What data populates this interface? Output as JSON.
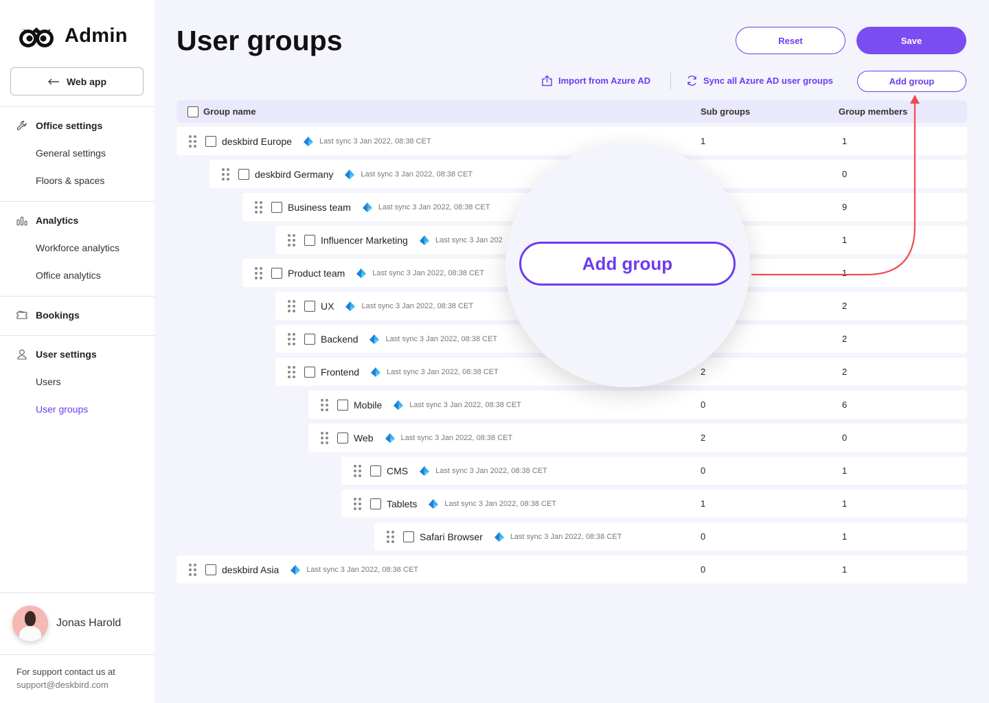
{
  "app": {
    "title": "Admin"
  },
  "sidebar": {
    "back_button": "Web app",
    "sections": [
      {
        "title": "Office settings",
        "icon": "wrench-icon",
        "items": [
          "General settings",
          "Floors & spaces"
        ]
      },
      {
        "title": "Analytics",
        "icon": "bar-chart-icon",
        "items": [
          "Workforce analytics",
          "Office analytics"
        ]
      },
      {
        "title": "Bookings",
        "icon": "ticket-icon",
        "items": []
      },
      {
        "title": "User settings",
        "icon": "user-icon",
        "items": [
          "Users",
          "User groups"
        ]
      }
    ],
    "active_item": "User groups",
    "user": {
      "name": "Jonas Harold"
    },
    "support": {
      "line": "For support contact us at",
      "email": "support@deskbird.com"
    }
  },
  "header": {
    "title": "User groups",
    "reset": "Reset",
    "save": "Save",
    "import_azure": "Import from Azure AD",
    "sync_azure": "Sync all Azure AD user groups",
    "add_group": "Add group"
  },
  "table": {
    "columns": [
      "Group name",
      "Sub groups",
      "Group members"
    ],
    "rows": [
      {
        "name": "deskbird Europe",
        "sync": "Last sync 3 Jan 2022, 08:38 CET",
        "sub": "1",
        "members": "1",
        "level": 0
      },
      {
        "name": "deskbird Germany",
        "sync": "Last sync 3 Jan 2022, 08:38 CET",
        "sub": "",
        "members": "0",
        "level": 1
      },
      {
        "name": "Business team",
        "sync": "Last sync 3 Jan 2022, 08:38 CET",
        "sub": "",
        "members": "9",
        "level": 2
      },
      {
        "name": "Influencer Marketing",
        "sync": "Last sync 3 Jan 202",
        "sub": "",
        "members": "1",
        "level": 3
      },
      {
        "name": "Product team",
        "sync": "Last sync 3 Jan 2022, 08:38 CET",
        "sub": "",
        "members": "1",
        "level": 2
      },
      {
        "name": "UX",
        "sync": "Last sync 3 Jan 2022, 08:38 CET",
        "sub": "",
        "members": "2",
        "level": 3
      },
      {
        "name": "Backend",
        "sync": "Last sync 3 Jan 2022, 08:38 CET",
        "sub": "",
        "members": "2",
        "level": 3
      },
      {
        "name": "Frontend",
        "sync": "Last sync 3 Jan 2022, 08:38 CET",
        "sub": "2",
        "members": "2",
        "level": 3
      },
      {
        "name": "Mobile",
        "sync": "Last sync 3 Jan 2022, 08:38 CET",
        "sub": "0",
        "members": "6",
        "level": 4
      },
      {
        "name": "Web",
        "sync": "Last sync 3 Jan 2022, 08:38 CET",
        "sub": "2",
        "members": "0",
        "level": 4
      },
      {
        "name": "CMS",
        "sync": "Last sync 3 Jan 2022, 08:38 CET",
        "sub": "0",
        "members": "1",
        "level": 5
      },
      {
        "name": "Tablets",
        "sync": "Last sync 3 Jan 2022, 08:38 CET",
        "sub": "1",
        "members": "1",
        "level": 5
      },
      {
        "name": "Safari Browser",
        "sync": "Last sync 3 Jan 2022, 08:38 CET",
        "sub": "0",
        "members": "1",
        "level": 6
      },
      {
        "name": "deskbird Asia",
        "sync": "Last sync 3 Jan 2022, 08:38 CET",
        "sub": "0",
        "members": "1",
        "level": 0
      }
    ]
  },
  "callout": {
    "label": "Add group",
    "arrow_color": "#ef4b52"
  },
  "colors": {
    "accent": "#6c3cf0",
    "save_bg": "#7c4cf3",
    "background": "#f4f4fc"
  }
}
